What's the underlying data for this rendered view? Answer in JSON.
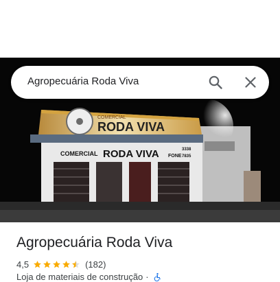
{
  "search": {
    "query": "Agropecuária Roda Viva"
  },
  "photo": {
    "sign_top_small": "COMERCIAL",
    "sign_top_big": "RODA VIVA",
    "facade_left": "COMERCIAL",
    "facade_center": "RODA VIVA",
    "facade_phone_label": "FONE",
    "facade_phone_a": "3338",
    "facade_phone_b": "7835"
  },
  "place": {
    "name": "Agropecuária Roda Viva",
    "rating": "4,5",
    "stars_value": 4.5,
    "review_count": "(182)",
    "category": "Loja de materiais de construção",
    "separator": "·"
  },
  "icons": {
    "search": "search-icon",
    "close": "close-icon",
    "star": "star-icon",
    "accessibility": "wheelchair-icon"
  },
  "colors": {
    "star": "#f9ab00",
    "accessibility": "#1a73e8",
    "text_primary": "#202124",
    "text_secondary": "#3c4043",
    "icon_gray": "#5f6368"
  }
}
